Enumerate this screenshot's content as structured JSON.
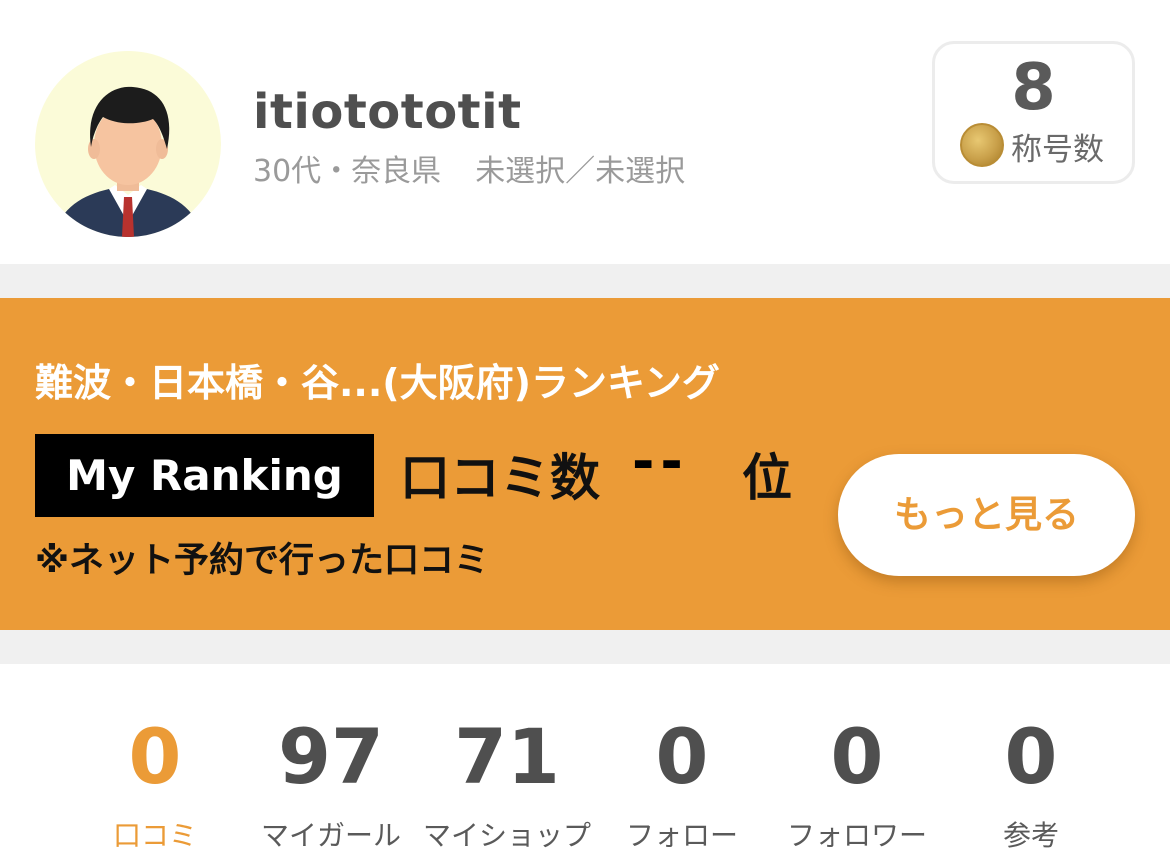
{
  "profile": {
    "username": "itiotototit",
    "age": "30代",
    "prefecture": "奈良県",
    "selection": "未選択／未選択",
    "title_count": "8",
    "title_label": "称号数"
  },
  "ranking": {
    "area_title": "難波・日本橋・谷...(大阪府)ランキング",
    "badge": "My Ranking",
    "kind": "口コミ数",
    "value": "--",
    "unit": "位",
    "note": "※ネット予約で行った口コミ",
    "more_button": "もっと見る"
  },
  "stats": [
    {
      "value": "0",
      "label": "口コミ"
    },
    {
      "value": "97",
      "label": "マイガール"
    },
    {
      "value": "71",
      "label": "マイショップ"
    },
    {
      "value": "0",
      "label": "フォロー"
    },
    {
      "value": "0",
      "label": "フォロワー"
    },
    {
      "value": "0",
      "label": "参考"
    }
  ],
  "colors": {
    "accent": "#eb9b37",
    "text_dark": "#4f4f4f",
    "text_muted": "#9a9a9a",
    "divider": "#f0f0f0"
  }
}
